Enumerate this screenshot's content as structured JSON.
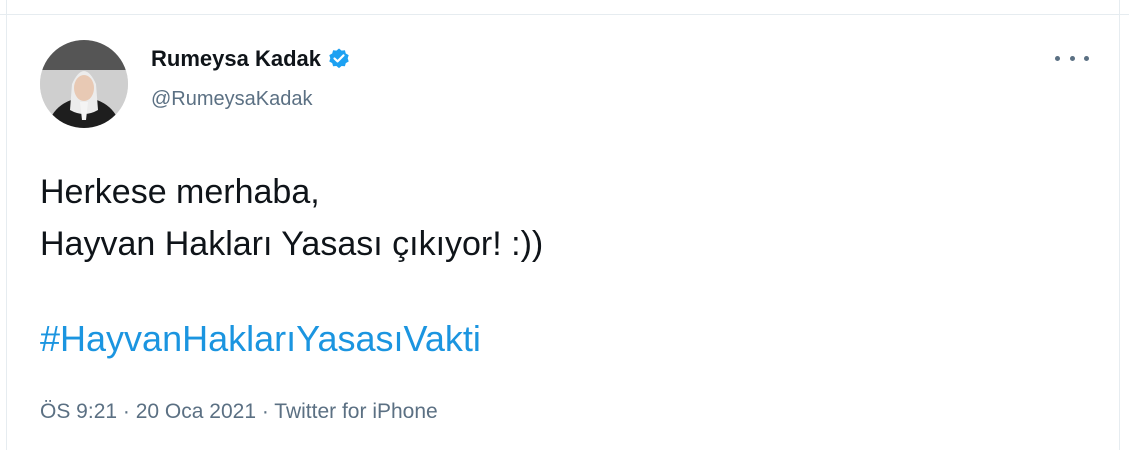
{
  "author": {
    "name": "Rumeysa Kadak",
    "handle": "@RumeysaKadak",
    "verified_icon": "verified-badge-icon",
    "avatar_icon": "profile-photo"
  },
  "tweet": {
    "lines": [
      "Herkese merhaba,",
      "Hayvan Hakları Yasası çıkıyor! :))"
    ],
    "hashtag": "#HayvanHaklarıYasasıVakti"
  },
  "meta": {
    "time": "ÖS 9:21",
    "separator": " · ",
    "date": "20 Oca 2021",
    "source": "Twitter for iPhone"
  },
  "colors": {
    "link": "#1b95e0",
    "secondary_text": "#5b7083",
    "verified": "#1da1f2"
  }
}
